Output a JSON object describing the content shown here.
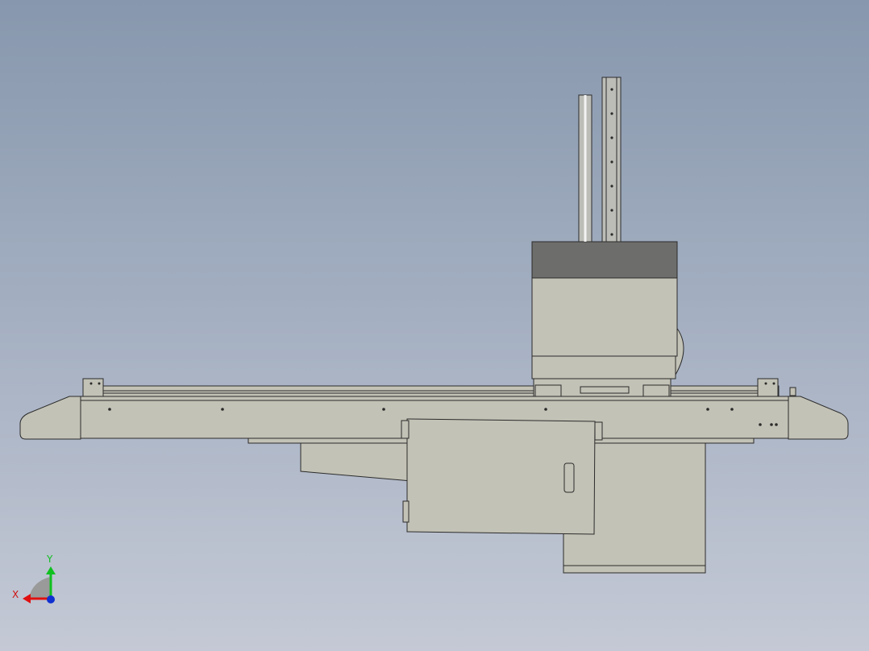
{
  "viewport": {
    "background_top": "#8797ad",
    "background_bottom": "#c4c9d5"
  },
  "model": {
    "part_fill": "#c3c2b6",
    "part_stroke": "#2b2b2b",
    "motor_cap_fill": "#6d6d6b",
    "column_fill": "#bdbdb8"
  },
  "triad": {
    "x_label": "X",
    "y_label": "Y",
    "x_color": "#e01010",
    "y_color": "#10c020",
    "z_color": "#1030d0"
  }
}
